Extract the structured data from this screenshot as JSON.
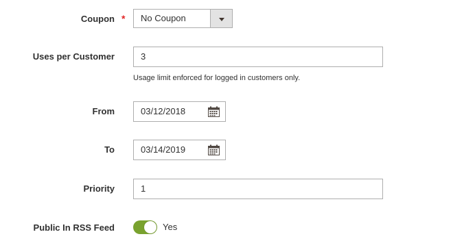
{
  "form": {
    "coupon": {
      "label": "Coupon",
      "required_mark": "*",
      "selected": "No Coupon"
    },
    "uses_per_customer": {
      "label": "Uses per Customer",
      "value": "3",
      "note": "Usage limit enforced for logged in customers only."
    },
    "from": {
      "label": "From",
      "value": "03/12/2018"
    },
    "to": {
      "label": "To",
      "value": "03/14/2019"
    },
    "priority": {
      "label": "Priority",
      "value": "1"
    },
    "rss_feed": {
      "label": "Public In RSS Feed",
      "state_text": "Yes",
      "enabled": true
    }
  },
  "colors": {
    "toggle_on": "#79a22e",
    "required": "#e22626",
    "border": "#adadad"
  },
  "icons": {
    "calendar": "calendar-icon",
    "dropdown": "chevron-down-icon"
  }
}
